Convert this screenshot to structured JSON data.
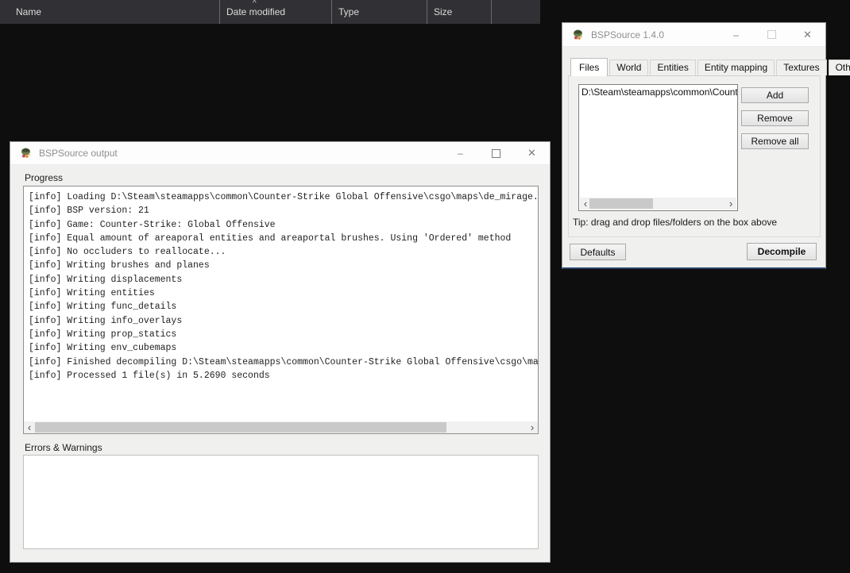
{
  "colors": {
    "desktop_bg": "#0e0e0e",
    "explorer_header_bg": "#313135",
    "window_bg": "#f0f0ee",
    "titlebar_bg": "#fdfdfd",
    "inactive_title_text": "#8f8f8f",
    "scrollbar_thumb": "#c9c9c9",
    "window_bottom_edge": "#274066"
  },
  "explorer_header": {
    "sort_indicator": "^",
    "columns": [
      "Name",
      "Date modified",
      "Type",
      "Size"
    ]
  },
  "scrollbar": {
    "left_arrow": "‹",
    "right_arrow": "›"
  },
  "output_window": {
    "title": "BSPSource output",
    "minimize_glyph": "–",
    "close_glyph": "✕",
    "progress_label": "Progress",
    "errors_label": "Errors & Warnings",
    "log_lines": [
      "[info] Loading D:\\Steam\\steamapps\\common\\Counter-Strike Global Offensive\\csgo\\maps\\de_mirage.",
      "[info] BSP version: 21",
      "[info] Game: Counter-Strike: Global Offensive",
      "[info] Equal amount of areaporal entities and areaportal brushes. Using 'Ordered' method",
      "[info] No occluders to reallocate...",
      "[info] Writing brushes and planes",
      "[info] Writing displacements",
      "[info] Writing entities",
      "[info] Writing func_details",
      "[info] Writing info_overlays",
      "[info] Writing prop_statics",
      "[info] Writing env_cubemaps",
      "[info] Finished decompiling D:\\Steam\\steamapps\\common\\Counter-Strike Global Offensive\\csgo\\ma",
      "[info] Processed 1 file(s) in 5.2690 seconds"
    ]
  },
  "main_window": {
    "title": "BSPSource 1.4.0",
    "minimize_glyph": "–",
    "close_glyph": "✕",
    "tabs": [
      {
        "label": "Files",
        "selected": true
      },
      {
        "label": "World"
      },
      {
        "label": "Entities"
      },
      {
        "label": "Entity mapping"
      },
      {
        "label": "Textures"
      },
      {
        "label": "Other"
      }
    ],
    "file_list": [
      "D:\\Steam\\steamapps\\common\\Counter-S"
    ],
    "add_label": "Add",
    "remove_label": "Remove",
    "remove_all_label": "Remove all",
    "tip_text": "Tip: drag and drop files/folders on the box above",
    "defaults_label": "Defaults",
    "decompile_label": "Decompile"
  }
}
